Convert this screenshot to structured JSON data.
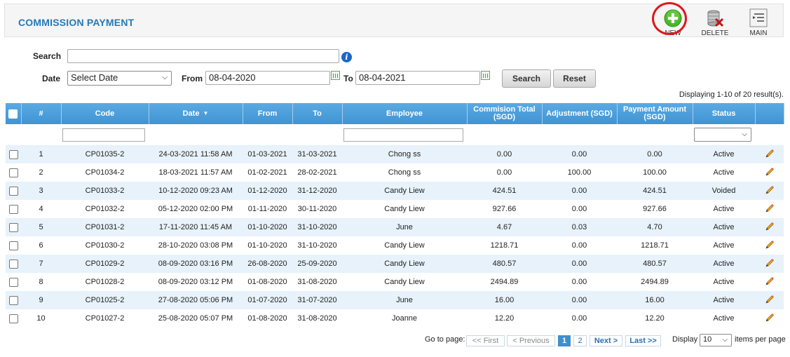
{
  "header": {
    "title": "COMMISSION PAYMENT",
    "tools": {
      "new_label": "NEW",
      "delete_label": "DELETE",
      "main_label": "MAIN"
    }
  },
  "filters": {
    "search_label": "Search",
    "search_value": "",
    "date_label": "Date",
    "date_select": "Select Date",
    "from_label": "From",
    "from_value": "08-04-2020",
    "to_label": "To",
    "to_value": "08-04-2021",
    "search_button": "Search",
    "reset_button": "Reset"
  },
  "result_info": "Displaying 1-10 of 20 result(s).",
  "table": {
    "columns": {
      "no": "#",
      "code": "Code",
      "date": "Date",
      "from": "From",
      "to": "To",
      "employee": "Employee",
      "commission_total": "Commision Total (SGD)",
      "adjustment": "Adjustment (SGD)",
      "payment_amount": "Payment Amount (SGD)",
      "status": "Status"
    },
    "rows": [
      {
        "no": "1",
        "code": "CP01035-2",
        "date": "24-03-2021 11:58 AM",
        "from": "01-03-2021",
        "to": "31-03-2021",
        "employee": "Chong ss",
        "commission": "0.00",
        "adjustment": "0.00",
        "payment": "0.00",
        "status": "Active"
      },
      {
        "no": "2",
        "code": "CP01034-2",
        "date": "18-03-2021 11:57 AM",
        "from": "01-02-2021",
        "to": "28-02-2021",
        "employee": "Chong ss",
        "commission": "0.00",
        "adjustment": "100.00",
        "payment": "100.00",
        "status": "Active"
      },
      {
        "no": "3",
        "code": "CP01033-2",
        "date": "10-12-2020 09:23 AM",
        "from": "01-12-2020",
        "to": "31-12-2020",
        "employee": "Candy Liew",
        "commission": "424.51",
        "adjustment": "0.00",
        "payment": "424.51",
        "status": "Voided"
      },
      {
        "no": "4",
        "code": "CP01032-2",
        "date": "05-12-2020 02:00 PM",
        "from": "01-11-2020",
        "to": "30-11-2020",
        "employee": "Candy Liew",
        "commission": "927.66",
        "adjustment": "0.00",
        "payment": "927.66",
        "status": "Active"
      },
      {
        "no": "5",
        "code": "CP01031-2",
        "date": "17-11-2020 11:45 AM",
        "from": "01-10-2020",
        "to": "31-10-2020",
        "employee": "June",
        "commission": "4.67",
        "adjustment": "0.03",
        "payment": "4.70",
        "status": "Active"
      },
      {
        "no": "6",
        "code": "CP01030-2",
        "date": "28-10-2020 03:08 PM",
        "from": "01-10-2020",
        "to": "31-10-2020",
        "employee": "Candy Liew",
        "commission": "1218.71",
        "adjustment": "0.00",
        "payment": "1218.71",
        "status": "Active"
      },
      {
        "no": "7",
        "code": "CP01029-2",
        "date": "08-09-2020 03:16 PM",
        "from": "26-08-2020",
        "to": "25-09-2020",
        "employee": "Candy Liew",
        "commission": "480.57",
        "adjustment": "0.00",
        "payment": "480.57",
        "status": "Active"
      },
      {
        "no": "8",
        "code": "CP01028-2",
        "date": "08-09-2020 03:12 PM",
        "from": "01-08-2020",
        "to": "31-08-2020",
        "employee": "Candy Liew",
        "commission": "2494.89",
        "adjustment": "0.00",
        "payment": "2494.89",
        "status": "Active"
      },
      {
        "no": "9",
        "code": "CP01025-2",
        "date": "27-08-2020 05:06 PM",
        "from": "01-07-2020",
        "to": "31-07-2020",
        "employee": "June",
        "commission": "16.00",
        "adjustment": "0.00",
        "payment": "16.00",
        "status": "Active"
      },
      {
        "no": "10",
        "code": "CP01027-2",
        "date": "25-08-2020 05:07 PM",
        "from": "01-08-2020",
        "to": "31-08-2020",
        "employee": "Joanne",
        "commission": "12.20",
        "adjustment": "0.00",
        "payment": "12.20",
        "status": "Active"
      }
    ]
  },
  "pagination": {
    "goto_label": "Go to page:",
    "first": "<< First",
    "previous": "< Previous",
    "pages": [
      "1",
      "2"
    ],
    "next": "Next >",
    "last": "Last >>",
    "display_label": "Display",
    "per_page_value": "10",
    "per_page_suffix": "items per page"
  },
  "colors": {
    "accent": "#2479b8",
    "header_bg": "#4d9fdc",
    "row_alt": "#e7f2fb",
    "highlight_ring": "#e0161d"
  }
}
